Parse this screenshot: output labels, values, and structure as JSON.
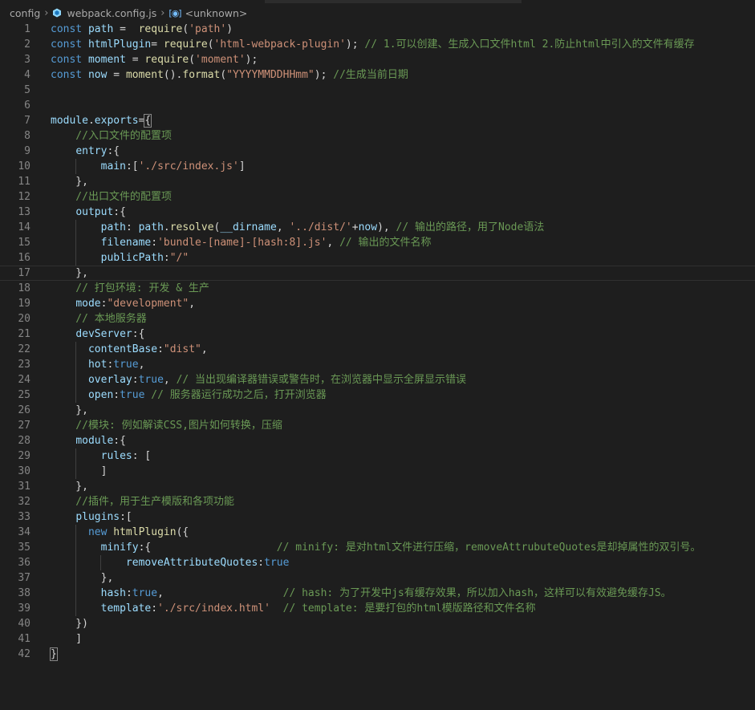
{
  "breadcrumb": {
    "folder": "config",
    "file": "webpack.config.js",
    "symbol": "<unknown>"
  },
  "colors": {
    "background": "#1e1e1e",
    "keyword": "#569cd6",
    "variable": "#9cdcfe",
    "function": "#dcdcaa",
    "string": "#ce9178",
    "comment": "#6a9955",
    "class": "#4ec9b0",
    "line_number": "#858585"
  },
  "current_line": 17,
  "lines": [
    {
      "n": "1",
      "tokens": [
        {
          "t": "const ",
          "c": "kw"
        },
        {
          "t": "path",
          "c": "var"
        },
        {
          "t": " =  ",
          "c": ""
        },
        {
          "t": "require",
          "c": "fn"
        },
        {
          "t": "(",
          "c": ""
        },
        {
          "t": "'path'",
          "c": "str"
        },
        {
          "t": ")",
          "c": ""
        }
      ]
    },
    {
      "n": "2",
      "tokens": [
        {
          "t": "const ",
          "c": "kw"
        },
        {
          "t": "htmlPlugin",
          "c": "var"
        },
        {
          "t": "= ",
          "c": ""
        },
        {
          "t": "require",
          "c": "fn"
        },
        {
          "t": "(",
          "c": ""
        },
        {
          "t": "'html-webpack-plugin'",
          "c": "str"
        },
        {
          "t": "); ",
          "c": ""
        },
        {
          "t": "// 1.可以创建、生成入口文件html 2.防止html中引入的文件有缓存",
          "c": "cm"
        }
      ]
    },
    {
      "n": "3",
      "tokens": [
        {
          "t": "const ",
          "c": "kw"
        },
        {
          "t": "moment",
          "c": "var"
        },
        {
          "t": " = ",
          "c": ""
        },
        {
          "t": "require",
          "c": "fn"
        },
        {
          "t": "(",
          "c": ""
        },
        {
          "t": "'moment'",
          "c": "str"
        },
        {
          "t": ");",
          "c": ""
        }
      ]
    },
    {
      "n": "4",
      "tokens": [
        {
          "t": "const ",
          "c": "kw"
        },
        {
          "t": "now",
          "c": "var"
        },
        {
          "t": " = ",
          "c": ""
        },
        {
          "t": "moment",
          "c": "fn"
        },
        {
          "t": "().",
          "c": ""
        },
        {
          "t": "format",
          "c": "fn"
        },
        {
          "t": "(",
          "c": ""
        },
        {
          "t": "\"YYYYMMDDHHmm\"",
          "c": "str"
        },
        {
          "t": "); ",
          "c": ""
        },
        {
          "t": "//生成当前日期",
          "c": "cm"
        }
      ]
    },
    {
      "n": "5",
      "tokens": []
    },
    {
      "n": "6",
      "tokens": []
    },
    {
      "n": "7",
      "tokens": [
        {
          "t": "module",
          "c": "var"
        },
        {
          "t": ".",
          "c": ""
        },
        {
          "t": "exports",
          "c": "var"
        },
        {
          "t": "=",
          "c": ""
        },
        {
          "t": "{",
          "c": "bracket"
        }
      ]
    },
    {
      "n": "8",
      "tokens": [
        {
          "t": "    //入口文件的配置项",
          "c": "cm"
        }
      ]
    },
    {
      "n": "9",
      "tokens": [
        {
          "t": "    ",
          "c": ""
        },
        {
          "t": "entry",
          "c": "var"
        },
        {
          "t": ":{",
          "c": ""
        }
      ]
    },
    {
      "n": "10",
      "tokens": [
        {
          "t": "        ",
          "c": ""
        },
        {
          "t": "main",
          "c": "var"
        },
        {
          "t": ":[",
          "c": ""
        },
        {
          "t": "'./src/index.js'",
          "c": "str"
        },
        {
          "t": "]",
          "c": ""
        }
      ]
    },
    {
      "n": "11",
      "tokens": [
        {
          "t": "    },",
          "c": ""
        }
      ]
    },
    {
      "n": "12",
      "tokens": [
        {
          "t": "    //出口文件的配置项",
          "c": "cm"
        }
      ]
    },
    {
      "n": "13",
      "tokens": [
        {
          "t": "    ",
          "c": ""
        },
        {
          "t": "output",
          "c": "var"
        },
        {
          "t": ":{",
          "c": ""
        }
      ]
    },
    {
      "n": "14",
      "tokens": [
        {
          "t": "        ",
          "c": ""
        },
        {
          "t": "path",
          "c": "var"
        },
        {
          "t": ": ",
          "c": ""
        },
        {
          "t": "path",
          "c": "var"
        },
        {
          "t": ".",
          "c": ""
        },
        {
          "t": "resolve",
          "c": "fn"
        },
        {
          "t": "(",
          "c": ""
        },
        {
          "t": "__dirname",
          "c": "var"
        },
        {
          "t": ", ",
          "c": ""
        },
        {
          "t": "'../dist/'",
          "c": "str"
        },
        {
          "t": "+",
          "c": ""
        },
        {
          "t": "now",
          "c": "var"
        },
        {
          "t": "), ",
          "c": ""
        },
        {
          "t": "// 输出的路径，用了Node语法",
          "c": "cm"
        }
      ]
    },
    {
      "n": "15",
      "tokens": [
        {
          "t": "        ",
          "c": ""
        },
        {
          "t": "filename",
          "c": "var"
        },
        {
          "t": ":",
          "c": ""
        },
        {
          "t": "'bundle-[name]-[hash:8].js'",
          "c": "str"
        },
        {
          "t": ", ",
          "c": ""
        },
        {
          "t": "// 输出的文件名称",
          "c": "cm"
        }
      ]
    },
    {
      "n": "16",
      "tokens": [
        {
          "t": "        ",
          "c": ""
        },
        {
          "t": "publicPath",
          "c": "var"
        },
        {
          "t": ":",
          "c": ""
        },
        {
          "t": "\"/\"",
          "c": "str"
        }
      ]
    },
    {
      "n": "17",
      "tokens": [
        {
          "t": "    },",
          "c": ""
        }
      ]
    },
    {
      "n": "18",
      "tokens": [
        {
          "t": "    // 打包环境: 开发 & 生产",
          "c": "cm"
        }
      ]
    },
    {
      "n": "19",
      "tokens": [
        {
          "t": "    ",
          "c": ""
        },
        {
          "t": "mode",
          "c": "var"
        },
        {
          "t": ":",
          "c": ""
        },
        {
          "t": "\"development\"",
          "c": "str"
        },
        {
          "t": ",",
          "c": ""
        }
      ]
    },
    {
      "n": "20",
      "tokens": [
        {
          "t": "    // 本地服务器",
          "c": "cm"
        }
      ]
    },
    {
      "n": "21",
      "tokens": [
        {
          "t": "    ",
          "c": ""
        },
        {
          "t": "devServer",
          "c": "var"
        },
        {
          "t": ":{",
          "c": ""
        }
      ]
    },
    {
      "n": "22",
      "tokens": [
        {
          "t": "      ",
          "c": ""
        },
        {
          "t": "contentBase",
          "c": "var"
        },
        {
          "t": ":",
          "c": ""
        },
        {
          "t": "\"dist\"",
          "c": "str"
        },
        {
          "t": ",",
          "c": ""
        }
      ]
    },
    {
      "n": "23",
      "tokens": [
        {
          "t": "      ",
          "c": ""
        },
        {
          "t": "hot",
          "c": "var"
        },
        {
          "t": ":",
          "c": ""
        },
        {
          "t": "true",
          "c": "kw"
        },
        {
          "t": ",",
          "c": ""
        }
      ]
    },
    {
      "n": "24",
      "tokens": [
        {
          "t": "      ",
          "c": ""
        },
        {
          "t": "overlay",
          "c": "var"
        },
        {
          "t": ":",
          "c": ""
        },
        {
          "t": "true",
          "c": "kw"
        },
        {
          "t": ", ",
          "c": ""
        },
        {
          "t": "// 当出现编译器错误或警告时，在浏览器中显示全屏显示错误",
          "c": "cm"
        }
      ]
    },
    {
      "n": "25",
      "tokens": [
        {
          "t": "      ",
          "c": ""
        },
        {
          "t": "open",
          "c": "var"
        },
        {
          "t": ":",
          "c": ""
        },
        {
          "t": "true",
          "c": "kw"
        },
        {
          "t": " ",
          "c": ""
        },
        {
          "t": "// 服务器运行成功之后，打开浏览器",
          "c": "cm"
        }
      ]
    },
    {
      "n": "26",
      "tokens": [
        {
          "t": "    },",
          "c": ""
        }
      ]
    },
    {
      "n": "27",
      "tokens": [
        {
          "t": "    //模块: 例如解读CSS,图片如何转换，压缩",
          "c": "cm"
        }
      ]
    },
    {
      "n": "28",
      "tokens": [
        {
          "t": "    ",
          "c": ""
        },
        {
          "t": "module",
          "c": "var"
        },
        {
          "t": ":{",
          "c": ""
        }
      ]
    },
    {
      "n": "29",
      "tokens": [
        {
          "t": "        ",
          "c": ""
        },
        {
          "t": "rules",
          "c": "var"
        },
        {
          "t": ": [",
          "c": ""
        }
      ]
    },
    {
      "n": "30",
      "tokens": [
        {
          "t": "        ]",
          "c": ""
        }
      ]
    },
    {
      "n": "31",
      "tokens": [
        {
          "t": "    },",
          "c": ""
        }
      ]
    },
    {
      "n": "32",
      "tokens": [
        {
          "t": "    //插件，用于生产模版和各项功能",
          "c": "cm"
        }
      ]
    },
    {
      "n": "33",
      "tokens": [
        {
          "t": "    ",
          "c": ""
        },
        {
          "t": "plugins",
          "c": "var"
        },
        {
          "t": ":[",
          "c": ""
        }
      ]
    },
    {
      "n": "34",
      "tokens": [
        {
          "t": "      ",
          "c": ""
        },
        {
          "t": "new ",
          "c": "kw"
        },
        {
          "t": "htmlPlugin",
          "c": "fn"
        },
        {
          "t": "({",
          "c": ""
        }
      ]
    },
    {
      "n": "35",
      "tokens": [
        {
          "t": "        ",
          "c": ""
        },
        {
          "t": "minify",
          "c": "var"
        },
        {
          "t": ":{                    ",
          "c": ""
        },
        {
          "t": "// minify: 是对html文件进行压缩，removeAttrubuteQuotes是却掉属性的双引号。",
          "c": "cm"
        }
      ]
    },
    {
      "n": "36",
      "tokens": [
        {
          "t": "            ",
          "c": ""
        },
        {
          "t": "removeAttributeQuotes",
          "c": "var"
        },
        {
          "t": ":",
          "c": ""
        },
        {
          "t": "true",
          "c": "kw"
        }
      ]
    },
    {
      "n": "37",
      "tokens": [
        {
          "t": "        },",
          "c": ""
        }
      ]
    },
    {
      "n": "38",
      "tokens": [
        {
          "t": "        ",
          "c": ""
        },
        {
          "t": "hash",
          "c": "var"
        },
        {
          "t": ":",
          "c": ""
        },
        {
          "t": "true",
          "c": "kw"
        },
        {
          "t": ",                   ",
          "c": ""
        },
        {
          "t": "// hash: 为了开发中js有缓存效果，所以加入hash，这样可以有效避免缓存JS。",
          "c": "cm"
        }
      ]
    },
    {
      "n": "39",
      "tokens": [
        {
          "t": "        ",
          "c": ""
        },
        {
          "t": "template",
          "c": "var"
        },
        {
          "t": ":",
          "c": ""
        },
        {
          "t": "'./src/index.html'",
          "c": "str"
        },
        {
          "t": "  ",
          "c": ""
        },
        {
          "t": "// template: 是要打包的html模版路径和文件名称",
          "c": "cm"
        }
      ]
    },
    {
      "n": "40",
      "tokens": [
        {
          "t": "    })",
          "c": ""
        }
      ]
    },
    {
      "n": "41",
      "tokens": [
        {
          "t": "    ]",
          "c": ""
        }
      ]
    },
    {
      "n": "42",
      "tokens": [
        {
          "t": "}",
          "c": "bracket"
        }
      ]
    }
  ]
}
